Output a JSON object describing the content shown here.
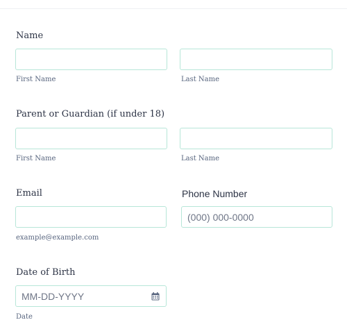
{
  "form": {
    "name": {
      "label": "Name",
      "first_value": "",
      "last_value": "",
      "first_sublabel": "First Name",
      "last_sublabel": "Last Name"
    },
    "guardian": {
      "label": "Parent or Guardian (if under 18)",
      "first_value": "",
      "last_value": "",
      "first_sublabel": "First Name",
      "last_sublabel": "Last Name"
    },
    "email": {
      "label": "Email",
      "value": "",
      "sublabel": "example@example.com"
    },
    "phone": {
      "label": "Phone Number",
      "value": "",
      "placeholder": "(000) 000-0000"
    },
    "dob": {
      "label": "Date of Birth",
      "value": "",
      "placeholder": "MM-DD-YYYY",
      "sublabel": "Date",
      "icon": "calendar-icon"
    }
  },
  "colors": {
    "input_border": "#b7e6d8",
    "label_text": "#2c3345",
    "sublabel_text": "#57647e"
  }
}
